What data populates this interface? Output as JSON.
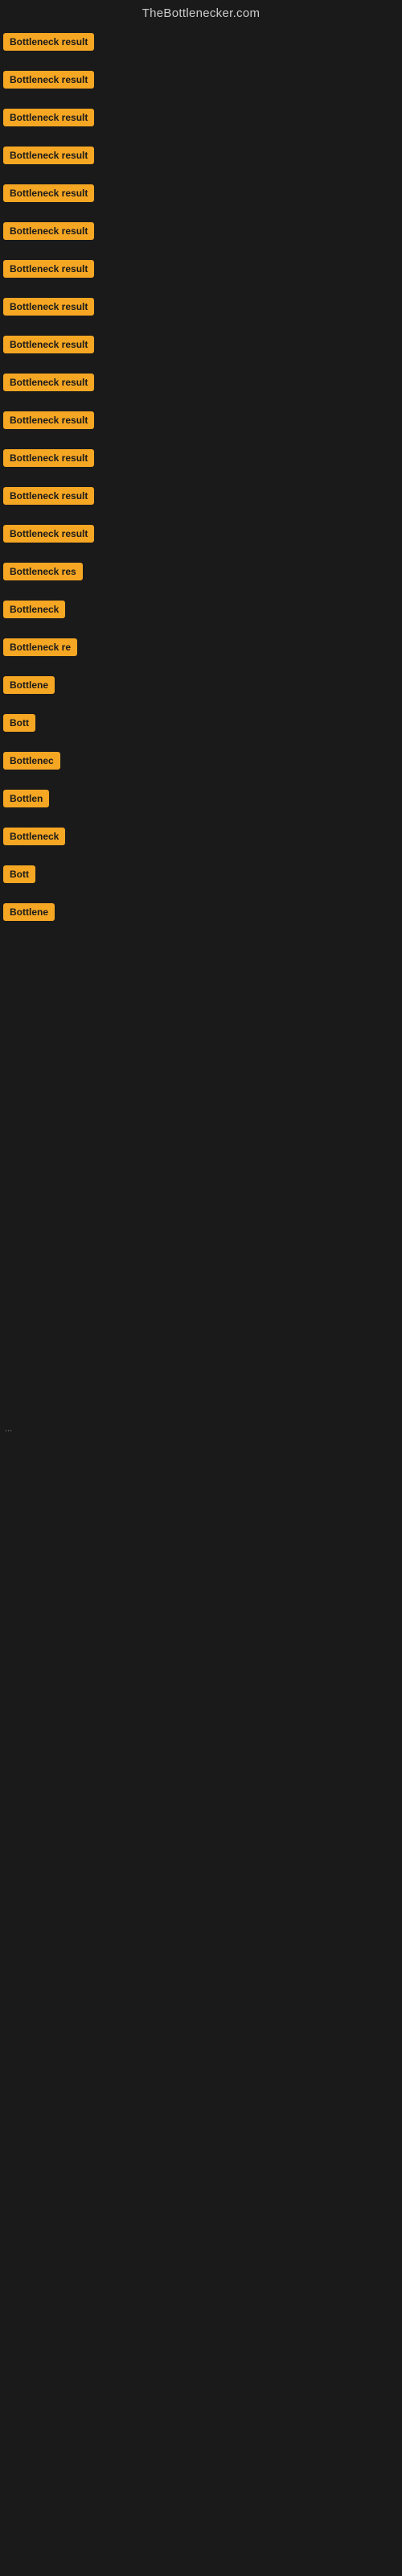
{
  "header": {
    "title": "TheBottlenecker.com"
  },
  "items": [
    {
      "id": 1,
      "label": "Bottleneck result",
      "badge_class": "badge-full",
      "spacing": 20
    },
    {
      "id": 2,
      "label": "Bottleneck result",
      "badge_class": "badge-full",
      "spacing": 20
    },
    {
      "id": 3,
      "label": "Bottleneck result",
      "badge_class": "badge-full",
      "spacing": 20
    },
    {
      "id": 4,
      "label": "Bottleneck result",
      "badge_class": "badge-full",
      "spacing": 20
    },
    {
      "id": 5,
      "label": "Bottleneck result",
      "badge_class": "badge-full",
      "spacing": 20
    },
    {
      "id": 6,
      "label": "Bottleneck result",
      "badge_class": "badge-full",
      "spacing": 20
    },
    {
      "id": 7,
      "label": "Bottleneck result",
      "badge_class": "badge-full",
      "spacing": 20
    },
    {
      "id": 8,
      "label": "Bottleneck result",
      "badge_class": "badge-full",
      "spacing": 20
    },
    {
      "id": 9,
      "label": "Bottleneck result",
      "badge_class": "badge-full",
      "spacing": 20
    },
    {
      "id": 10,
      "label": "Bottleneck result",
      "badge_class": "badge-full",
      "spacing": 20
    },
    {
      "id": 11,
      "label": "Bottleneck result",
      "badge_class": "badge-full",
      "spacing": 20
    },
    {
      "id": 12,
      "label": "Bottleneck result",
      "badge_class": "badge-full",
      "spacing": 20
    },
    {
      "id": 13,
      "label": "Bottleneck result",
      "badge_class": "badge-full",
      "spacing": 20
    },
    {
      "id": 14,
      "label": "Bottleneck result",
      "badge_class": "badge-full",
      "spacing": 20
    },
    {
      "id": 15,
      "label": "Bottleneck res",
      "badge_class": "badge-w130",
      "spacing": 20
    },
    {
      "id": 16,
      "label": "Bottleneck",
      "badge_class": "badge-w80",
      "spacing": 20
    },
    {
      "id": 17,
      "label": "Bottleneck re",
      "badge_class": "badge-w100",
      "spacing": 20
    },
    {
      "id": 18,
      "label": "Bottlene",
      "badge_class": "badge-w70",
      "spacing": 20
    },
    {
      "id": 19,
      "label": "Bott",
      "badge_class": "badge-w45",
      "spacing": 20
    },
    {
      "id": 20,
      "label": "Bottlenec",
      "badge_class": "badge-w75",
      "spacing": 20
    },
    {
      "id": 21,
      "label": "Bottlen",
      "badge_class": "badge-w65",
      "spacing": 20
    },
    {
      "id": 22,
      "label": "Bottleneck",
      "badge_class": "badge-w80",
      "spacing": 20
    },
    {
      "id": 23,
      "label": "Bott",
      "badge_class": "badge-w45",
      "spacing": 20
    },
    {
      "id": 24,
      "label": "Bottlene",
      "badge_class": "badge-w70",
      "spacing": 20
    }
  ],
  "ellipsis": "..."
}
